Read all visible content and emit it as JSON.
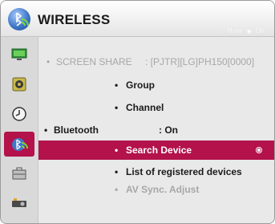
{
  "header": {
    "title": "WIRELESS",
    "hint_move": "Move",
    "hint_ok": "OK",
    "icon": "bluetooth-wireless-icon"
  },
  "sidebar": {
    "items": [
      {
        "icon": "picture-monitor-icon"
      },
      {
        "icon": "sound-speaker-icon"
      },
      {
        "icon": "clock-icon"
      },
      {
        "icon": "bluetooth-wireless-icon",
        "active": true
      },
      {
        "icon": "toolbox-option-icon"
      },
      {
        "icon": "projector-icon"
      }
    ]
  },
  "menu": {
    "screen_share_label": "SCREEN SHARE",
    "screen_share_value": ": [PJTR][LG]PH150[0000]",
    "group": "Group",
    "channel": "Channel",
    "bluetooth_label": "Bluetooth",
    "bluetooth_value": ": On",
    "search_device": "Search Device",
    "list_registered": "List of registered devices",
    "av_sync": "AV Sync. Adjust",
    "bullet": "•"
  },
  "colors": {
    "accent": "#b3124a",
    "muted_text": "#a7a7a7",
    "text": "#1b1b1b"
  }
}
